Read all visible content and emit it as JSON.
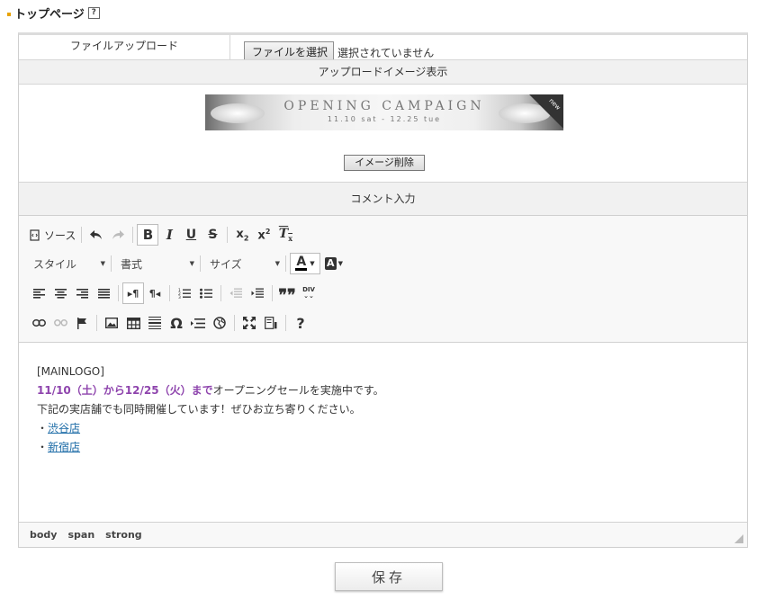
{
  "section": {
    "title": "トップページ",
    "help": "?"
  },
  "file_row": {
    "label": "ファイルアップロード",
    "button": "ファイルを選択",
    "status": "選択されていません"
  },
  "image_row": {
    "header": "アップロードイメージ表示",
    "banner": {
      "title": "OPENING CAMPAIGN",
      "date": "11.10 sat - 12.25 tue",
      "badge": "new"
    },
    "delete_button": "イメージ削除"
  },
  "comment_row": {
    "header": "コメント入力"
  },
  "editor": {
    "toolbar": {
      "source_label": "ソース",
      "style_combo": "スタイル",
      "format_combo": "書式",
      "size_combo": "サイズ"
    },
    "content": {
      "line1": "[MAINLOGO]",
      "line2_bold": "11/10（土）から12/25（火）まで",
      "line2_rest": "オープニングセールを実施中です。",
      "line3": "下記の実店舗でも同時開催しています！ぜひお立ち寄りください。",
      "bullet": "・",
      "link1": "渋谷店",
      "link2": "新宿店"
    },
    "path": [
      "body",
      "span",
      "strong"
    ]
  },
  "save_button": "保存",
  "colors": {
    "accent_bullet": "#e8a300",
    "purple_text": "#8e44ad",
    "link": "#1a6aa6"
  }
}
